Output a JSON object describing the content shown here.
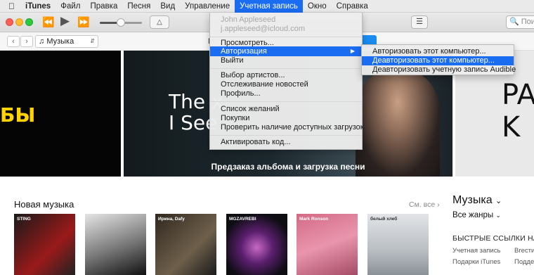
{
  "menubar": {
    "apple_icon": "apple-icon",
    "items": [
      "iTunes",
      "Файл",
      "Правка",
      "Песня",
      "Вид",
      "Управление",
      "Учетная запись",
      "Окно",
      "Справка"
    ],
    "active": "Учетная запись"
  },
  "toolbar": {
    "icons": [
      "rewind-icon",
      "play-icon",
      "fast-forward-icon",
      "airplay-icon",
      "list-icon"
    ],
    "volume_level": 0.5,
    "search_placeholder": "Поиск"
  },
  "navbar": {
    "media": "Музыка",
    "tab_fragment": "М"
  },
  "banner": {
    "left_text": "БЫ",
    "headline_line1": "The x",
    "headline_line2": "I See",
    "caption": "Предзаказ альбома и загрузка песни",
    "right_text_line1": "PA",
    "right_text_line2": "K"
  },
  "section": {
    "title": "Новая музыка",
    "see_all": "См. все",
    "albums": [
      {
        "text": "STING"
      },
      {
        "text": ""
      },
      {
        "text": "Ирина, Dafy"
      },
      {
        "text": "MGZAVREBI"
      },
      {
        "text": "Mark Ronson"
      },
      {
        "text": "белый хлеб"
      }
    ]
  },
  "sidebar": {
    "title": "Музыка",
    "genres": "Все жанры",
    "quick_links_title": "БЫСТРЫЕ ССЫЛКИ НА",
    "links": [
      "Учетная запись",
      "Вгести",
      "Подарки iTunes",
      "Поддер"
    ]
  },
  "account_menu": {
    "user_name": "John Appleseed",
    "user_email": "j.appleseed@icloud.com",
    "items": [
      "Просмотреть...",
      "Авторизация",
      "Выйти",
      "Выбор артистов...",
      "Отслеживание новостей",
      "Профиль...",
      "Список желаний",
      "Покупки",
      "Проверить наличие доступных загрузок",
      "Активировать код..."
    ],
    "highlighted": "Авторизация"
  },
  "authorization_submenu": {
    "items": [
      "Авторизовать этот компьютер...",
      "Деавторизовать этот компьютер...",
      "Деавторизовать учетную запись Audible"
    ],
    "highlighted": "Деавторизовать этот компьютер..."
  },
  "colors": {
    "highlight": "#1a6cf1",
    "banner_accent": "#ffd400"
  }
}
